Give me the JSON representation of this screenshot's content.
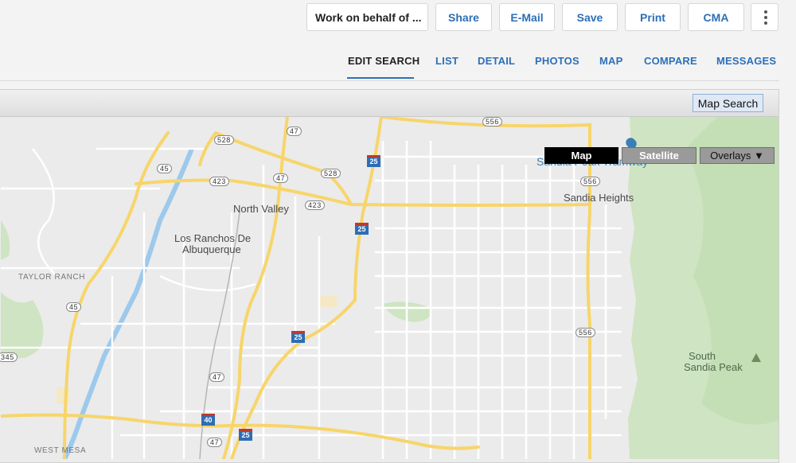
{
  "toolbar": {
    "work_on_behalf": "Work on behalf of ...",
    "share": "Share",
    "email": "E-Mail",
    "save": "Save",
    "print": "Print",
    "cma": "CMA"
  },
  "tabs": [
    {
      "label": "EDIT SEARCH",
      "active": true
    },
    {
      "label": "LIST"
    },
    {
      "label": "DETAIL"
    },
    {
      "label": "PHOTOS"
    },
    {
      "label": "MAP"
    },
    {
      "label": "COMPARE"
    },
    {
      "label": "MESSAGES"
    }
  ],
  "map": {
    "search_button": "Map Search",
    "type_map": "Map",
    "type_satellite": "Satellite",
    "overlays": "Overlays ▼",
    "labels": {
      "north_valley": "North Valley",
      "los_ranchos": "Los Ranchos De",
      "albuquerque": "Albuquerque",
      "taylor_ranch": "TAYLOR RANCH",
      "west_mesa": "WEST MESA",
      "sandia_tramway": "Sandia Peak Tramway",
      "sandia_heights": "Sandia Heights",
      "south_sandia_1": "South",
      "south_sandia_2": "Sandia Peak"
    },
    "shields": {
      "r556": "556",
      "r47": "47",
      "r528": "528",
      "r45": "45",
      "r423": "423",
      "i25": "25",
      "i40": "40",
      "r345": "345"
    },
    "colors": {
      "road_major": "#f7d56a",
      "terrain": "#cfe4c2",
      "water": "#9cc9ec",
      "interstate": "#2d6db5"
    }
  }
}
